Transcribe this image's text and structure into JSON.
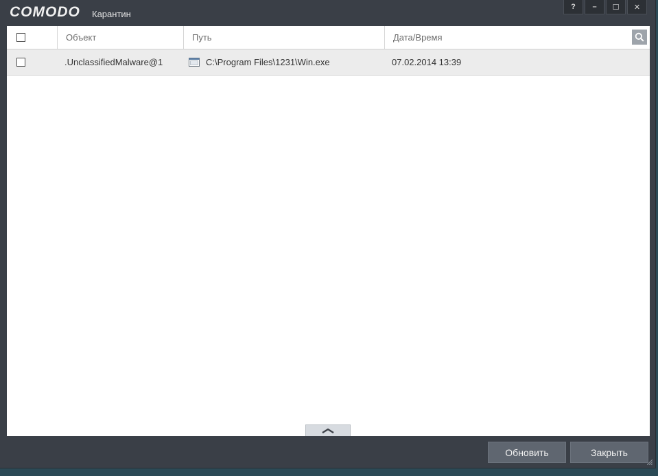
{
  "window": {
    "logo": "COMODO",
    "title": "Карантин",
    "buttons": {
      "help": "?",
      "minimize": "–",
      "maximize": "☐",
      "close": "✕"
    }
  },
  "table": {
    "columns": [
      "Объект",
      "Путь",
      "Дата/Время"
    ],
    "rows": [
      {
        "object": ".UnclassifiedMalware@1",
        "path": "C:\\Program Files\\1231\\Win.exe",
        "datetime": "07.02.2014 13:39"
      }
    ]
  },
  "footer": {
    "refresh_label": "Обновить",
    "close_label": "Закрыть"
  },
  "icons": {
    "search": "search-icon",
    "collapse": "chevron-up-icon",
    "file": "exe-file-icon"
  },
  "colors": {
    "window_bg": "#3a3f47",
    "content_bg": "#ffffff",
    "row_bg": "#ececec",
    "button_bg": "#5f6670"
  }
}
